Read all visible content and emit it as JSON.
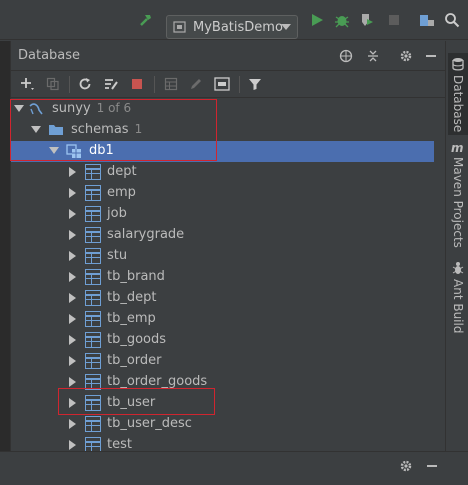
{
  "toolbar": {
    "run_config": "MyBatisDemo",
    "icons": [
      "hammer-icon",
      "run-icon",
      "debug-icon",
      "coverage-icon",
      "stop-icon",
      "project-structure-icon",
      "search-icon"
    ]
  },
  "panel": {
    "title": "Database",
    "header_icons": [
      "globe-icon",
      "collapse-icon",
      "gear-icon",
      "minimize-icon"
    ],
    "toolbar_icons": [
      "add-icon",
      "copy-icon",
      "refresh-icon",
      "schema-sync-icon",
      "stop-icon",
      "table-editor-icon",
      "edit-icon",
      "console-icon",
      "filter-icon"
    ]
  },
  "tree": {
    "root": {
      "label": "sunyy",
      "sub": "1 of 6"
    },
    "schemas": {
      "label": "schemas",
      "sub": "1"
    },
    "db": {
      "label": "db1"
    },
    "tables": [
      "dept",
      "emp",
      "job",
      "salarygrade",
      "stu",
      "tb_brand",
      "tb_dept",
      "tb_emp",
      "tb_goods",
      "tb_order",
      "tb_order_goods",
      "tb_user",
      "tb_user_desc",
      "test"
    ]
  },
  "right_stripe": {
    "tabs": [
      {
        "label": "Database",
        "icon": "database-icon",
        "active": true
      },
      {
        "label": "Maven Projects",
        "icon": "maven-icon",
        "active": false
      },
      {
        "label": "Ant Build",
        "icon": "ant-icon",
        "active": false
      }
    ]
  },
  "colors": {
    "background": "#3c3f41",
    "selection": "#4b6eaf",
    "highlight": "#d0252f",
    "table_icon": "#6f9fd4",
    "run_green": "#499c54"
  }
}
